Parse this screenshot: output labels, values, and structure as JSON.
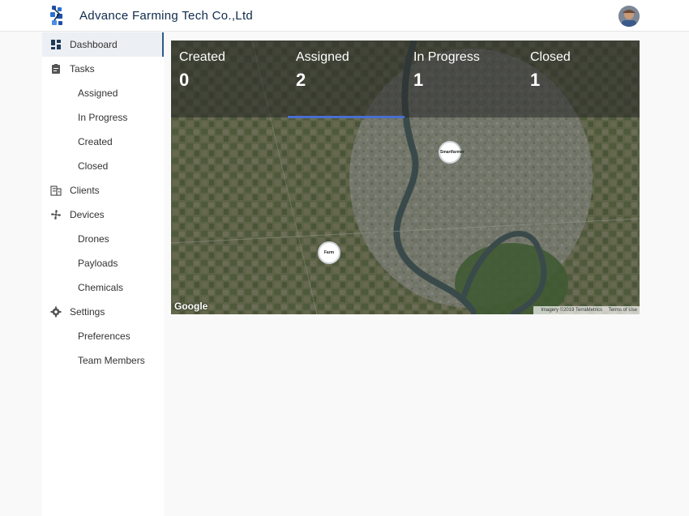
{
  "header": {
    "title": "Advance Farming Tech Co.,Ltd",
    "logo_icon": "drone-logo-icon",
    "avatar_icon": "user-avatar"
  },
  "sidebar": {
    "items": [
      {
        "label": "Dashboard",
        "icon": "dashboard-icon",
        "active": true
      },
      {
        "label": "Tasks",
        "icon": "clipboard-icon"
      },
      {
        "label": "Assigned",
        "sub": true
      },
      {
        "label": "In Progress",
        "sub": true
      },
      {
        "label": "Created",
        "sub": true
      },
      {
        "label": "Closed",
        "sub": true
      },
      {
        "label": "Clients",
        "icon": "building-icon"
      },
      {
        "label": "Devices",
        "icon": "fan-icon"
      },
      {
        "label": "Drones",
        "sub": true
      },
      {
        "label": "Payloads",
        "sub": true
      },
      {
        "label": "Chemicals",
        "sub": true
      },
      {
        "label": "Settings",
        "icon": "gear-icon"
      },
      {
        "label": "Preferences",
        "sub": true
      },
      {
        "label": "Team Members",
        "sub": true
      }
    ]
  },
  "stats": [
    {
      "label": "Created",
      "value": "0"
    },
    {
      "label": "Assigned",
      "value": "2"
    },
    {
      "label": "In Progress",
      "value": "1"
    },
    {
      "label": "Closed",
      "value": "1"
    }
  ],
  "map": {
    "markers": [
      {
        "name": "Smartfarmer"
      },
      {
        "name": "Farm"
      }
    ],
    "google_logo": "Google",
    "imagery_credit": "Imagery ©2019 TerraMetrics",
    "terms": "Terms of Use"
  },
  "colors": {
    "accent": "#2f5a8a",
    "tab_indicator": "#4a6fd1",
    "title": "#0f2a4a"
  }
}
